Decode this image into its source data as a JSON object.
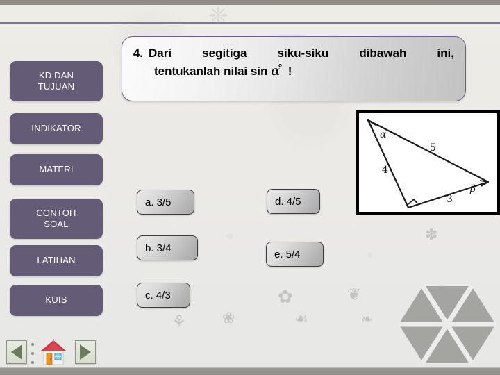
{
  "slide": {
    "background_color": "#eceae5",
    "accent_color": "#6b6484",
    "sidebar_button_color": "#645b77"
  },
  "sidebar": {
    "items": [
      {
        "label": "KD DAN\nTUJUAN",
        "line1": "KD DAN",
        "line2": "TUJUAN",
        "name": "kd-dan-tujuan"
      },
      {
        "label": "INDIKATOR",
        "line1": "INDIKATOR",
        "line2": "",
        "name": "indikator"
      },
      {
        "label": "MATERI",
        "line1": "MATERI",
        "line2": "",
        "name": "materi"
      },
      {
        "label": "CONTOH\nSOAL",
        "line1": "CONTOH",
        "line2": "SOAL",
        "name": "contoh-soal"
      },
      {
        "label": "LATIHAN",
        "line1": "LATIHAN",
        "line2": "",
        "name": "latihan"
      },
      {
        "label": "KUIS",
        "line1": "KUIS",
        "line2": "",
        "name": "kuis"
      }
    ]
  },
  "question": {
    "number": "4.",
    "line1": "Dari segitiga siku-siku dibawah ini,",
    "line2_prefix": "tentukanlah nilai sin",
    "symbol": "α",
    "degree": "°",
    "line2_suffix": "!"
  },
  "figure": {
    "caption": "right-triangle-diagram",
    "angle_labels": [
      "α",
      "β"
    ],
    "side_labels": [
      "5",
      "4",
      "3"
    ],
    "alpha": "α",
    "beta": "β",
    "side_hypotenuse": "5",
    "side_adjacent": "4",
    "side_opposite": "3"
  },
  "options": [
    {
      "key": "a",
      "label": "a. 3/5"
    },
    {
      "key": "b",
      "label": "b. 3/4"
    },
    {
      "key": "c",
      "label": "c. 4/3"
    },
    {
      "key": "d",
      "label": "d. 4/5"
    },
    {
      "key": "e",
      "label": "e. 5/4"
    }
  ],
  "footer_nav": {
    "prev_icon": "triangle-left-icon",
    "home_icon": "home-icon",
    "next_icon": "triangle-right-icon"
  },
  "ornaments": {
    "motifs": [
      "❁",
      "⚘",
      "❀",
      "✿",
      "☙",
      "❦",
      "❧",
      "✽",
      "❈"
    ]
  }
}
